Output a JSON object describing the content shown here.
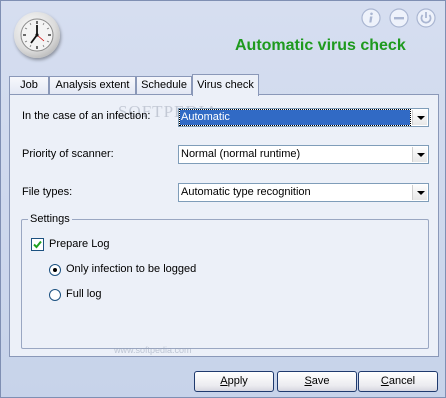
{
  "header": {
    "title": "Automatic virus check",
    "clock_icon": "clock-icon",
    "info_icon": "info-icon",
    "minimize_icon": "minimize-icon",
    "power_icon": "power-icon"
  },
  "tabs": [
    {
      "label": "Job",
      "active": false
    },
    {
      "label": "Analysis extent",
      "active": false
    },
    {
      "label": "Schedule",
      "active": false
    },
    {
      "label": "Virus check",
      "active": true
    }
  ],
  "form": {
    "infection_label": "In the case of an infection:",
    "infection_value": "Automatic",
    "priority_label": "Priority of scanner:",
    "priority_value": "Normal (normal runtime)",
    "filetypes_label": "File types:",
    "filetypes_value": "Automatic type recognition"
  },
  "settings": {
    "title": "Settings",
    "prepare_log_label": "Prepare Log",
    "prepare_log_checked": true,
    "only_infection_label": "Only infection to be logged",
    "only_infection_selected": true,
    "full_log_label": "Full log",
    "full_log_selected": false
  },
  "watermark": {
    "logo_text": "SOFTPEDIA",
    "url": "www.softpedia.com"
  },
  "buttons": {
    "apply_pre": "",
    "apply_u": "A",
    "apply_post": "pply",
    "save_pre": "",
    "save_u": "S",
    "save_post": "ave",
    "cancel_pre": "",
    "cancel_u": "C",
    "cancel_post": "ancel"
  },
  "colors": {
    "title_green": "#1e9a1e",
    "selection_blue": "#316ac5",
    "panel_bg": "#ecf0f8",
    "window_bg": "#c7d3ea"
  }
}
